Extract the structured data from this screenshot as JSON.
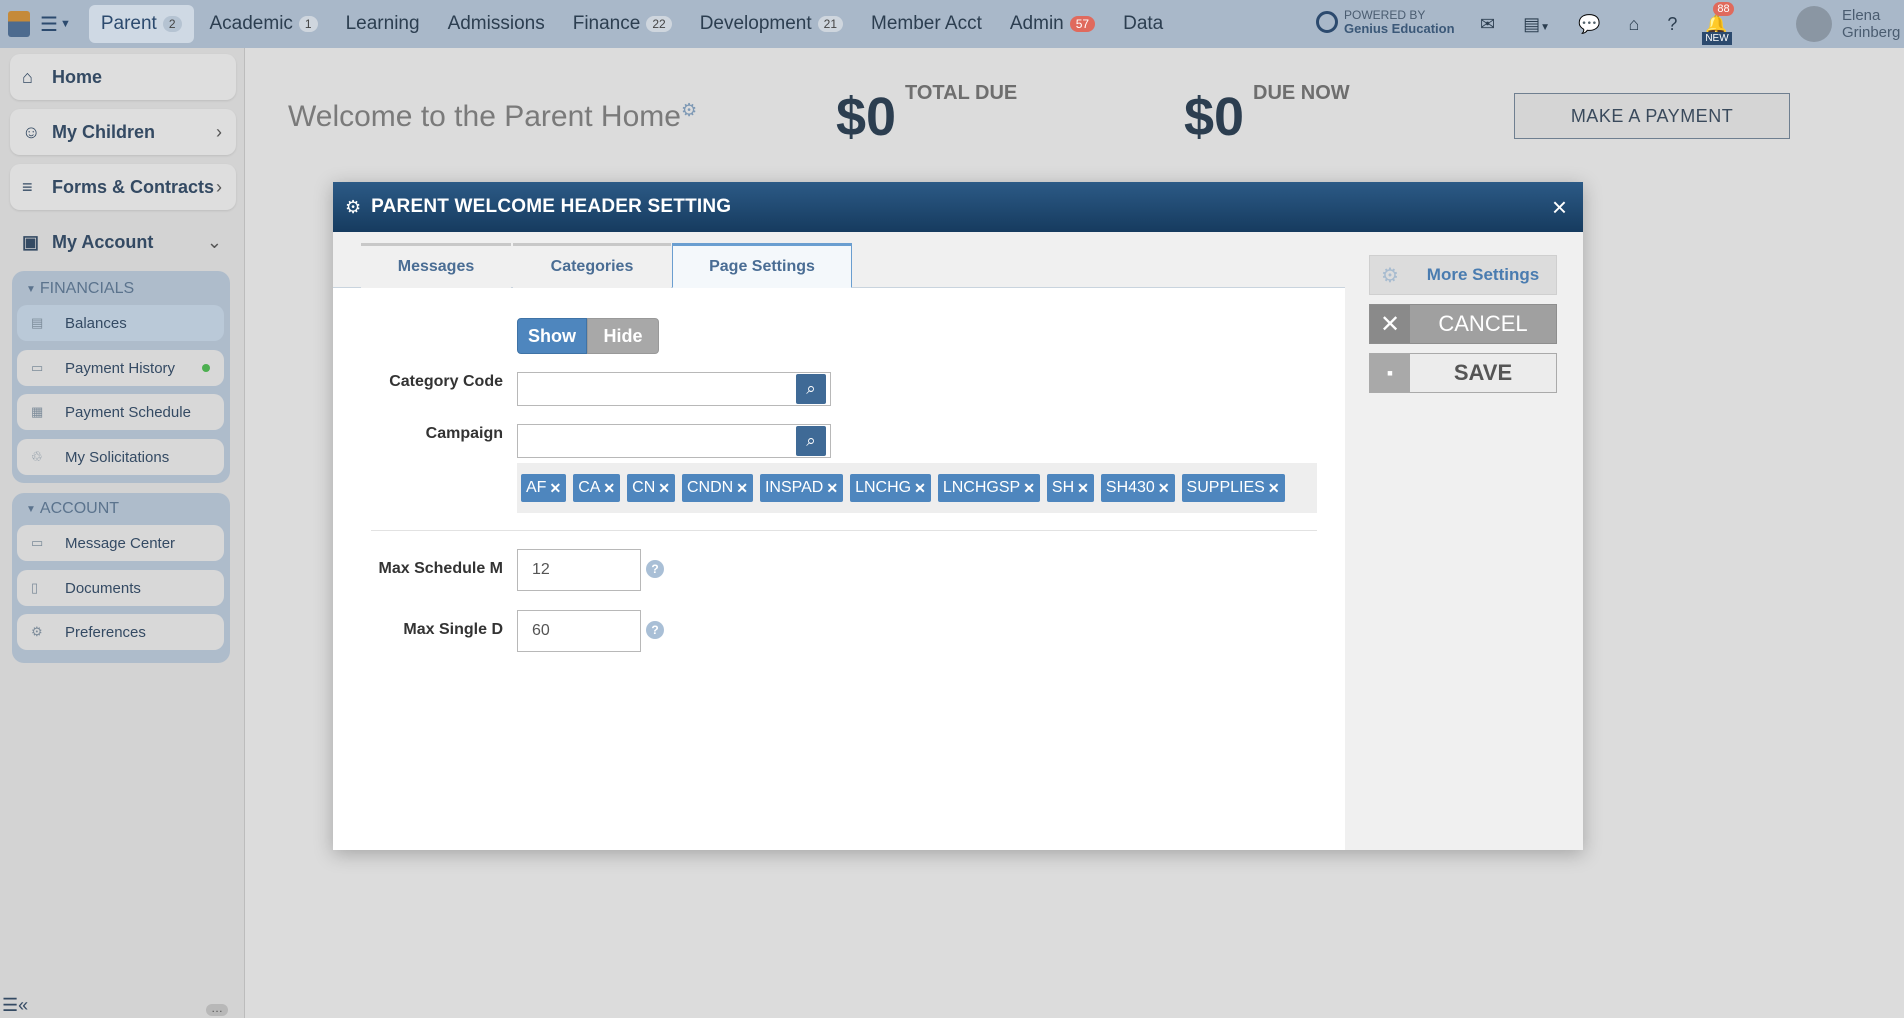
{
  "topnav": {
    "items": [
      {
        "label": "Parent",
        "badge": "2",
        "active": true
      },
      {
        "label": "Academic",
        "badge": "1"
      },
      {
        "label": "Learning"
      },
      {
        "label": "Admissions"
      },
      {
        "label": "Finance",
        "badge": "22"
      },
      {
        "label": "Development",
        "badge": "21"
      },
      {
        "label": "Member Acct"
      },
      {
        "label": "Admin",
        "badge": "57",
        "badge_color": "#e06a5d"
      },
      {
        "label": "Data"
      }
    ],
    "powered_by": "POWERED BY",
    "brand": "Genius Education",
    "bell_count": "88",
    "new_label": "NEW",
    "user_first": "Elena",
    "user_last": "Grinberg"
  },
  "sidebar": {
    "home": "Home",
    "children": "My Children",
    "forms": "Forms & Contracts",
    "account": "My Account",
    "financials_title": "FINANCIALS",
    "financials": [
      "Balances",
      "Payment History",
      "Payment Schedule",
      "My Solicitations"
    ],
    "account_title": "ACCOUNT",
    "account_items": [
      "Message Center",
      "Documents",
      "Preferences"
    ]
  },
  "page": {
    "welcome": "Welcome to the Parent Home",
    "total_due_amount": "$0",
    "total_due_label": "TOTAL DUE",
    "due_now_amount": "$0",
    "due_now_label": "DUE NOW",
    "make_payment": "MAKE A PAYMENT"
  },
  "modal": {
    "title": "PARENT WELCOME HEADER SETTING",
    "close": "×",
    "tabs": [
      "Messages",
      "Categories",
      "Page Settings"
    ],
    "active_tab": "Page Settings",
    "show_label": "Show",
    "hide_label": "Hide",
    "category_code_label": "Category Code",
    "category_code_value": "",
    "campaign_label": "Campaign",
    "campaign_value": "",
    "campaign_tags": [
      "AF",
      "CA",
      "CN",
      "CNDN",
      "INSPAD",
      "LNCHG",
      "LNCHGSP",
      "SH",
      "SH430",
      "SUPPLIES"
    ],
    "max_schedule_label": "Max Schedule M",
    "max_schedule_value": "12",
    "max_single_label": "Max Single D",
    "max_single_value": "60",
    "more_settings": "More Settings",
    "cancel": "CANCEL",
    "save": "SAVE"
  },
  "colors": {
    "accent": "#4e86be",
    "header": "#1e4a74",
    "nav": "#a9b8c9"
  }
}
